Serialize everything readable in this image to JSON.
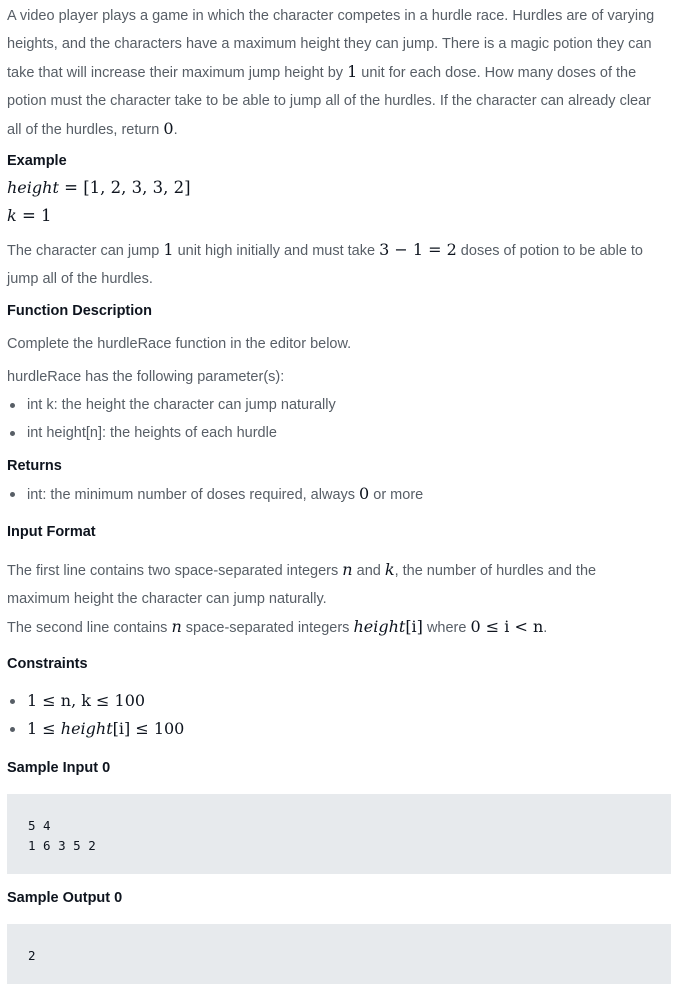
{
  "intro": {
    "line1": "A video player plays a game in which the character competes in a hurdle race. Hurdles are of varying",
    "line2": "heights, and the characters have a maximum height they can jump. There is a magic potion they can",
    "line3a": "take that will increase their maximum jump height by ",
    "line3m": "1",
    "line3b": " unit for each dose. How many doses of the",
    "line4": "potion must the character take to be able to jump all of the hurdles. If the character can already clear",
    "line5a": "all of the hurdles, return ",
    "line5m": "0",
    "line5b": "."
  },
  "example": {
    "heading": "Example",
    "height_var": "height",
    "height_val": " = [1, 2, 3, 3, 2]",
    "k_var": "k",
    "k_val": " = 1",
    "expl1a": "The character can jump ",
    "expl1m": "1",
    "expl1b": " unit high initially and must take ",
    "expl1m2": "3 − 1 = 2",
    "expl1c": " doses of potion to be able to",
    "expl2": "jump all of the hurdles."
  },
  "function_description": {
    "heading": "Function Description",
    "text": "Complete the hurdleRace function in the editor below.",
    "params_intro": "hurdleRace has the following parameter(s):",
    "params": [
      "int k: the height the character can jump naturally",
      "int height[n]: the heights of each hurdle"
    ]
  },
  "returns": {
    "heading": "Returns",
    "item_a": "int: the minimum number of doses required, always ",
    "item_m": "0",
    "item_b": " or more"
  },
  "input_format": {
    "heading": "Input Format",
    "l1a": "The first line contains two space-separated integers ",
    "l1n": "n",
    "l1b": " and ",
    "l1k": "k",
    "l1c": ", the number of hurdles and the",
    "l2": "maximum height the character can jump naturally.",
    "l3a": "The second line contains ",
    "l3n": "n",
    "l3b": " space-separated integers ",
    "l3h": "height",
    "l3i": "[i]",
    "l3c": " where ",
    "l3m": "0 ≤ i < n",
    "l3d": "."
  },
  "constraints": {
    "heading": "Constraints",
    "c1": "1 ≤ n, k ≤ 100",
    "c2a": "1 ≤ ",
    "c2h": "height",
    "c2b": "[i] ≤ 100"
  },
  "sample_input": {
    "heading": "Sample Input 0",
    "code": "5 4\n1 6 3 5 2"
  },
  "sample_output": {
    "heading": "Sample Output 0",
    "code": "2"
  }
}
